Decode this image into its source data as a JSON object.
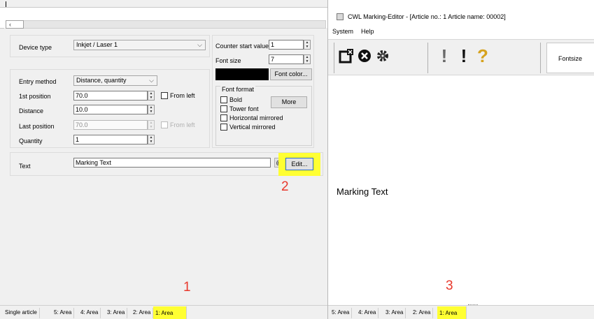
{
  "left": {
    "scroll_start": "‹",
    "device_type": {
      "label": "Device type",
      "value": "Inkjet / Laser 1"
    },
    "counter_start": {
      "label": "Counter start value",
      "value": "1"
    },
    "font_size": {
      "label": "Font size",
      "value": "7"
    },
    "font_color_button": "Font color...",
    "color_swatch": "#000000",
    "entry_method": {
      "label": "Entry method",
      "value": "Distance, quantity"
    },
    "first_position": {
      "label": "1st position",
      "value": "70.0",
      "from_left": "From left"
    },
    "distance": {
      "label": "Distance",
      "value": "10.0"
    },
    "last_position": {
      "label": "Last position",
      "value": "70.0",
      "from_left": "From left"
    },
    "quantity": {
      "label": "Quantity",
      "value": "1"
    },
    "font_format": {
      "title": "Font format",
      "bold": "Bold",
      "tower": "Tower font",
      "horizontal": "Horizontal mirrored",
      "vertical": "Vertical mirrored",
      "more_button": "More"
    },
    "text": {
      "label": "Text",
      "value": "Marking Text",
      "at_button": "@",
      "edit_button": "Edit..."
    },
    "annotations": {
      "edit": "2",
      "tab": "1"
    },
    "tabs": [
      "Single article",
      "5: Area",
      "4: Area",
      "3: Area",
      "2: Area",
      "1: Area"
    ]
  },
  "right": {
    "title": "CWL Marking-Editor - [Article no.: 1   Article name: 00002]",
    "menu": [
      "System",
      "Help"
    ],
    "toolbar": {
      "fontsize_label": "Fontsize",
      "icons": [
        "save-exit-icon",
        "close-icon",
        "settings-gear-icon",
        "exclamation-icon",
        "exclamation-icon",
        "question-icon"
      ]
    },
    "canvas_text": "Marking Text",
    "annotation": "3",
    "tabs": [
      "5: Area",
      "4: Area",
      "3: Area",
      "2: Area",
      "1: Area"
    ]
  },
  "colors": {
    "highlight": "#ffff33",
    "annotation": "#e8382c",
    "question_mark": "#d6a21e"
  }
}
